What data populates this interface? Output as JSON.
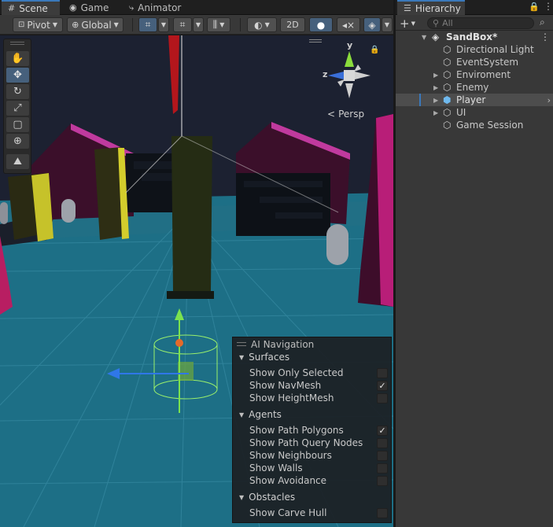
{
  "scene_tabs": [
    {
      "label": "Scene",
      "icon": "grid-icon"
    },
    {
      "label": "Game",
      "icon": "gamepad-icon"
    },
    {
      "label": "Animator",
      "icon": "animator-icon"
    }
  ],
  "toolbar": {
    "pivot_label": "Pivot",
    "global_label": "Global",
    "twod_label": "2D"
  },
  "viewport": {
    "persp_label": "Persp",
    "axis_y": "y",
    "axis_z": "z",
    "colors": {
      "ground": "#1d6f86",
      "sky": "#1e2433",
      "accent": "#3a79bb"
    }
  },
  "ai_navigation": {
    "title": "AI Navigation",
    "sections": [
      {
        "name": "Surfaces",
        "options": [
          {
            "label": "Show Only Selected",
            "checked": false
          },
          {
            "label": "Show NavMesh",
            "checked": true
          },
          {
            "label": "Show HeightMesh",
            "checked": false
          }
        ]
      },
      {
        "name": "Agents",
        "options": [
          {
            "label": "Show Path Polygons",
            "checked": true
          },
          {
            "label": "Show Path Query Nodes",
            "checked": false
          },
          {
            "label": "Show Neighbours",
            "checked": false
          },
          {
            "label": "Show Walls",
            "checked": false
          },
          {
            "label": "Show Avoidance",
            "checked": false
          }
        ]
      },
      {
        "name": "Obstacles",
        "options": [
          {
            "label": "Show Carve Hull",
            "checked": false
          }
        ]
      }
    ]
  },
  "hierarchy": {
    "tab_label": "Hierarchy",
    "search_placeholder": "All",
    "scene_name": "SandBox*",
    "items": [
      {
        "label": "Directional Light",
        "expandable": false,
        "selected": false
      },
      {
        "label": "EventSystem",
        "expandable": false,
        "selected": false
      },
      {
        "label": "Enviroment",
        "expandable": true,
        "selected": false
      },
      {
        "label": "Enemy",
        "expandable": true,
        "selected": false
      },
      {
        "label": "Player",
        "expandable": true,
        "selected": true
      },
      {
        "label": "UI",
        "expandable": true,
        "selected": false
      },
      {
        "label": "Game Session",
        "expandable": false,
        "selected": false
      }
    ]
  }
}
